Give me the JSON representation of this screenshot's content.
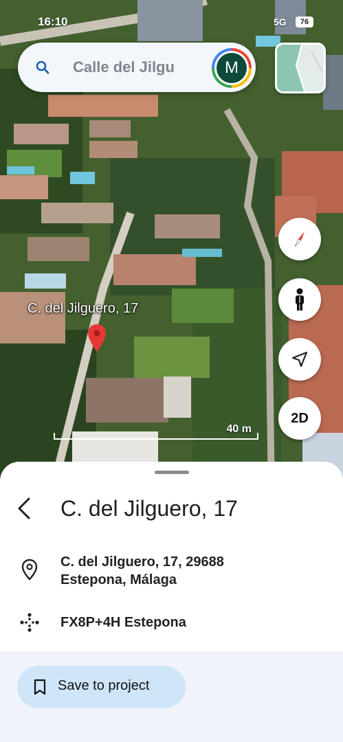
{
  "status_bar": {
    "time": "16:10",
    "network": "5G",
    "battery": "76"
  },
  "search": {
    "query": "Calle del Jilgu",
    "avatar_letter": "M"
  },
  "map": {
    "location_label": "C. del Jilguero, 17",
    "scale_label": "40 m",
    "toggle_2d_label": "2D"
  },
  "sheet": {
    "title": "C. del Jilguero, 17",
    "address_line1": "C. del Jilguero, 17, 29688",
    "address_line2": "Estepona, Málaga",
    "plus_code": "FX8P+4H Estepona",
    "save_label": "Save to project"
  },
  "colors": {
    "accent": "#cfe6f8",
    "pin": "#e53935",
    "sheet_bg": "#ffffff"
  }
}
